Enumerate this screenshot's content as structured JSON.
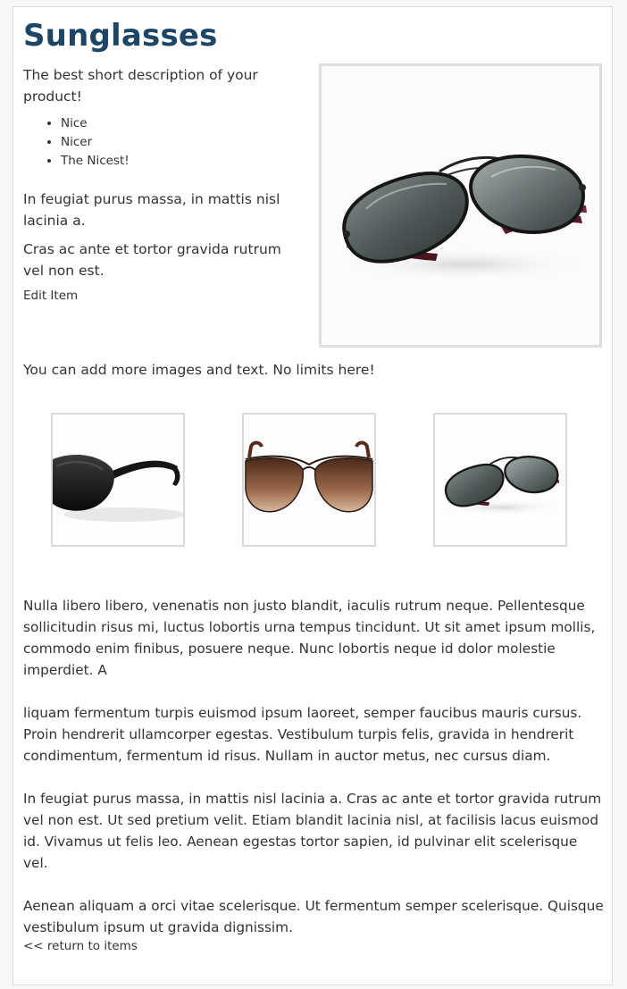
{
  "product": {
    "title": "Sunglasses",
    "short_description": "The best short description of your product!",
    "features": [
      "Nice",
      "Nicer",
      "The Nicest!"
    ],
    "paragraph_1": "In feugiat purus massa, in mattis nisl lacinia a.",
    "paragraph_2": "Cras ac ante et tortor gravida rutrum vel non est.",
    "edit_label": "Edit Item"
  },
  "gallery": {
    "intro": "You can add more images and text. No limits here!",
    "main_image_icon": "aviator-sunglasses-image",
    "thumbnails": [
      {
        "icon": "black-wrap-sunglasses-image"
      },
      {
        "icon": "brown-gradient-sunglasses-image"
      },
      {
        "icon": "aviator-sunglasses-image"
      }
    ]
  },
  "body_text": [
    "Nulla libero libero, venenatis non justo blandit, iaculis rutrum neque. Pellentesque sollicitudin risus mi, luctus lobortis urna tempus tincidunt. Ut sit amet ipsum mollis, commodo enim finibus, posuere neque. Nunc lobortis neque id dolor molestie imperdiet. A",
    "liquam fermentum turpis euismod ipsum laoreet, semper faucibus mauris cursus. Proin hendrerit ullamcorper egestas. Vestibulum turpis felis, gravida in hendrerit condimentum, fermentum id risus. Nullam in auctor metus, nec cursus diam.",
    "In feugiat purus massa, in mattis nisl lacinia a. Cras ac ante et tortor gravida rutrum vel non est. Ut sed pretium velit. Etiam blandit lacinia nisl, at facilisis lacus euismod id. Vivamus ut felis leo. Aenean egestas tortor sapien, id pulvinar elit scelerisque vel.",
    "Aenean aliquam a orci vitae scelerisque. Ut fermentum semper scelerisque. Quisque vestibulum ipsum ut gravida dignissim."
  ],
  "navigation": {
    "return_label": "<< return to items"
  },
  "colors": {
    "title": "#1d4666",
    "text": "#333333",
    "image_border": "#dedede",
    "lens_dark": "#3e4846",
    "frame_red": "#6e1d2f"
  }
}
